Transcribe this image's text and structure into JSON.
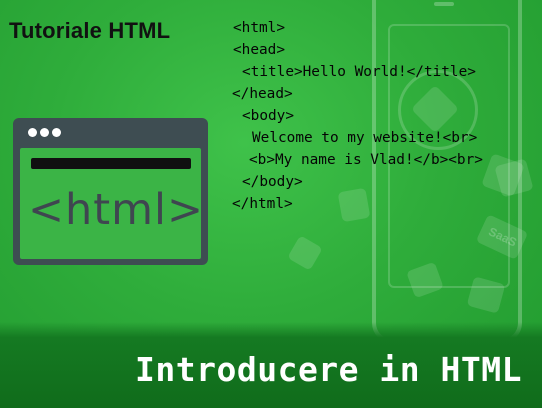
{
  "header": {
    "title": "Tutoriale HTML"
  },
  "illustration": {
    "browser_label": "<html>"
  },
  "code": {
    "lines": [
      "<html>",
      "<head>",
      "<title>Hello World!</title>",
      "</head>",
      "<body>",
      "Welcome to my website!<br>",
      "<b>My name is Vlad!</b><br>",
      "</body>",
      "</html>"
    ]
  },
  "decorations": {
    "saas_label": "SaaS"
  },
  "banner": {
    "title": "Introducere in HTML"
  },
  "colors": {
    "background": "#2fad3b",
    "banner": "#157a22",
    "window_frame": "#3e4d52",
    "code_text": "#050505"
  }
}
